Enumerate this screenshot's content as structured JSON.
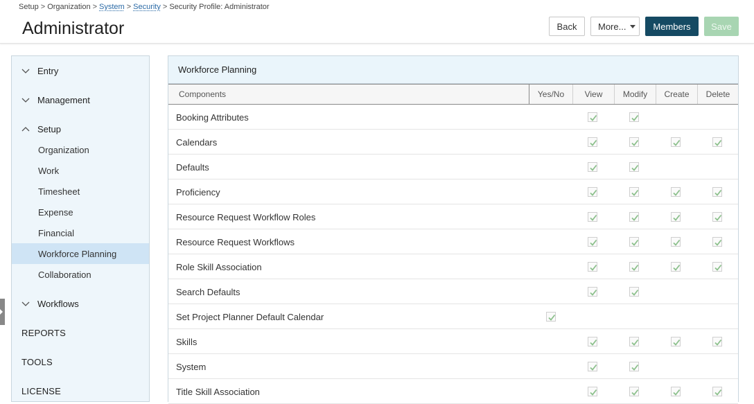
{
  "breadcrumb": {
    "items": [
      "Setup",
      "Organization",
      "System",
      "Security",
      "Security Profile: Administrator"
    ],
    "separator": ">"
  },
  "header": {
    "title": "Administrator"
  },
  "toolbar": {
    "back_label": "Back",
    "more_label": "More...",
    "members_label": "Members",
    "save_label": "Save"
  },
  "sidebar": {
    "groups": [
      {
        "label": "Entry",
        "expanded": false
      },
      {
        "label": "Management",
        "expanded": false
      },
      {
        "label": "Setup",
        "expanded": true
      },
      {
        "label": "Workflows",
        "expanded": false
      }
    ],
    "setup_items": [
      "Organization",
      "Work",
      "Timesheet",
      "Expense",
      "Financial",
      "Workforce Planning",
      "Collaboration"
    ],
    "active_item": "Workforce Planning",
    "top_items": [
      "REPORTS",
      "TOOLS",
      "LICENSE"
    ]
  },
  "panel": {
    "title": "Workforce Planning",
    "columns": [
      "Components",
      "Yes/No",
      "View",
      "Modify",
      "Create",
      "Delete"
    ],
    "rows": [
      {
        "name": "Booking Attributes",
        "yesno": false,
        "view": true,
        "modify": true,
        "create": false,
        "delete": false
      },
      {
        "name": "Calendars",
        "yesno": false,
        "view": true,
        "modify": true,
        "create": true,
        "delete": true
      },
      {
        "name": "Defaults",
        "yesno": false,
        "view": true,
        "modify": true,
        "create": false,
        "delete": false
      },
      {
        "name": "Proficiency",
        "yesno": false,
        "view": true,
        "modify": true,
        "create": true,
        "delete": true
      },
      {
        "name": "Resource Request Workflow Roles",
        "yesno": false,
        "view": true,
        "modify": true,
        "create": true,
        "delete": true
      },
      {
        "name": "Resource Request Workflows",
        "yesno": false,
        "view": true,
        "modify": true,
        "create": true,
        "delete": true
      },
      {
        "name": "Role Skill Association",
        "yesno": false,
        "view": true,
        "modify": true,
        "create": true,
        "delete": true
      },
      {
        "name": "Search Defaults",
        "yesno": false,
        "view": true,
        "modify": true,
        "create": false,
        "delete": false
      },
      {
        "name": "Set Project Planner Default Calendar",
        "yesno": true,
        "view": false,
        "modify": false,
        "create": false,
        "delete": false
      },
      {
        "name": "Skills",
        "yesno": false,
        "view": true,
        "modify": true,
        "create": true,
        "delete": true
      },
      {
        "name": "System",
        "yesno": false,
        "view": true,
        "modify": true,
        "create": false,
        "delete": false
      },
      {
        "name": "Title Skill Association",
        "yesno": false,
        "view": true,
        "modify": true,
        "create": true,
        "delete": true
      }
    ]
  },
  "colors": {
    "accent": "#154a63",
    "save_disabled": "#a8d5b2",
    "check": "#8cc08c",
    "active_nav": "#cfe4f5",
    "link": "#2b6aa6"
  }
}
